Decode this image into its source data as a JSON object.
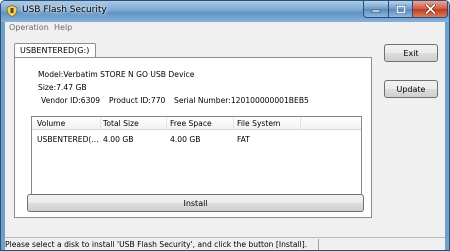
{
  "window": {
    "title": "USB Flash Security",
    "icon": "usb-shield-icon",
    "controls": [
      "minimize-icon",
      "maximize-icon",
      "close-icon"
    ]
  },
  "menu": {
    "items": [
      {
        "label": "Operation"
      },
      {
        "label": "Help"
      }
    ]
  },
  "tab": {
    "label": "USBENTERED(G:)"
  },
  "device": {
    "model": "Model:Verbatim STORE N GO USB Device",
    "size": "Size:7.47 GB",
    "vendor": "Vendor ID:6309",
    "product": "Product ID:770",
    "serial": "Serial Number:120100000001BEB5"
  },
  "volumes": {
    "columns": [
      "Volume",
      "Total Size",
      "Free Space",
      "File System"
    ],
    "rows": [
      [
        "USBENTERED(...",
        "4.00 GB",
        "4.00 GB",
        "FAT"
      ]
    ]
  },
  "buttons": {
    "install": "Install",
    "exit": "Exit",
    "update": "Update"
  },
  "status": {
    "text": "Please select a disk to install 'USB Flash Security', and click the button [Install]."
  },
  "colors": {
    "titlebar": "#7aa8d2",
    "close_button": "#c0391d",
    "dialog_bg": "#f0f0f0"
  }
}
